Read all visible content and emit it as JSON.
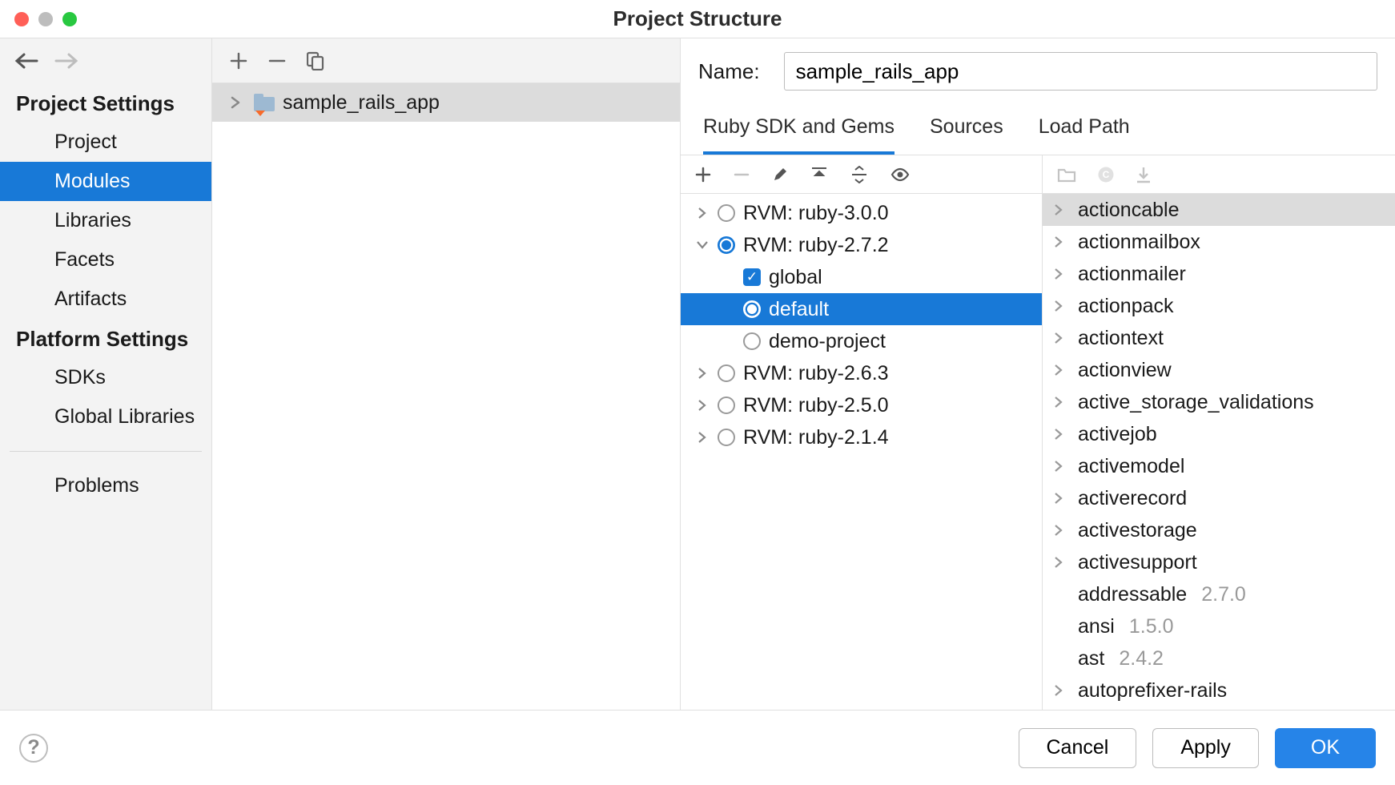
{
  "title": "Project Structure",
  "sidebar": {
    "sections": [
      {
        "title": "Project Settings",
        "items": [
          "Project",
          "Modules",
          "Libraries",
          "Facets",
          "Artifacts"
        ]
      },
      {
        "title": "Platform Settings",
        "items": [
          "SDKs",
          "Global Libraries"
        ]
      }
    ],
    "problems": "Problems"
  },
  "module_name": "sample_rails_app",
  "name_label": "Name:",
  "name_value": "sample_rails_app",
  "tabs": [
    "Ruby SDK and Gems",
    "Sources",
    "Load Path"
  ],
  "sdks": [
    {
      "label": "RVM: ruby-3.0.0",
      "expanded": false,
      "selected": false
    },
    {
      "label": "RVM: ruby-2.7.2",
      "expanded": true,
      "selected": true,
      "children": [
        {
          "label": "global",
          "type": "checkbox"
        },
        {
          "label": "default",
          "type": "radio",
          "selected": true
        },
        {
          "label": "demo-project",
          "type": "radio",
          "selected": false
        }
      ]
    },
    {
      "label": "RVM: ruby-2.6.3",
      "expanded": false,
      "selected": false
    },
    {
      "label": "RVM: ruby-2.5.0",
      "expanded": false,
      "selected": false
    },
    {
      "label": "RVM: ruby-2.1.4",
      "expanded": false,
      "selected": false
    }
  ],
  "gems": [
    {
      "name": "actioncable",
      "expandable": true,
      "selected": true
    },
    {
      "name": "actionmailbox",
      "expandable": true
    },
    {
      "name": "actionmailer",
      "expandable": true
    },
    {
      "name": "actionpack",
      "expandable": true
    },
    {
      "name": "actiontext",
      "expandable": true
    },
    {
      "name": "actionview",
      "expandable": true
    },
    {
      "name": "active_storage_validations",
      "expandable": true
    },
    {
      "name": "activejob",
      "expandable": true
    },
    {
      "name": "activemodel",
      "expandable": true
    },
    {
      "name": "activerecord",
      "expandable": true
    },
    {
      "name": "activestorage",
      "expandable": true
    },
    {
      "name": "activesupport",
      "expandable": true
    },
    {
      "name": "addressable",
      "version": "2.7.0"
    },
    {
      "name": "ansi",
      "version": "1.5.0"
    },
    {
      "name": "ast",
      "version": "2.4.2"
    },
    {
      "name": "autoprefixer-rails",
      "expandable": true
    }
  ],
  "footer": {
    "cancel": "Cancel",
    "apply": "Apply",
    "ok": "OK"
  }
}
